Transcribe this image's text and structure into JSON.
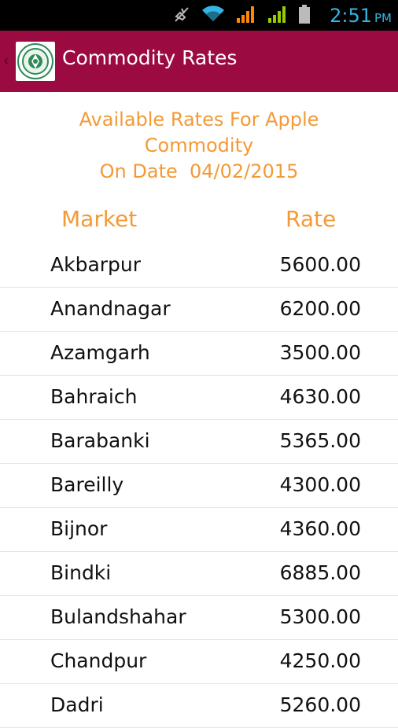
{
  "status_bar": {
    "time": "2:51",
    "ampm": "PM",
    "accent_color": "#33b5e5",
    "icons": [
      "mute-icon",
      "wifi-icon",
      "signal-icon-1",
      "signal-icon-2",
      "battery-icon"
    ]
  },
  "action_bar": {
    "title": "Commodity Rates",
    "background_color": "#9b0a40"
  },
  "heading": {
    "line1": "Available Rates For Apple",
    "line2": "Commodity",
    "line3": "On Date  04/02/2015"
  },
  "table": {
    "header_market": "Market",
    "header_rate": "Rate",
    "rows": [
      {
        "market": "Akbarpur",
        "rate": "5600.00"
      },
      {
        "market": "Anandnagar",
        "rate": "6200.00"
      },
      {
        "market": "Azamgarh",
        "rate": "3500.00"
      },
      {
        "market": "Bahraich",
        "rate": "4630.00"
      },
      {
        "market": "Barabanki",
        "rate": "5365.00"
      },
      {
        "market": "Bareilly",
        "rate": "4300.00"
      },
      {
        "market": "Bijnor",
        "rate": "4360.00"
      },
      {
        "market": "Bindki",
        "rate": "6885.00"
      },
      {
        "market": "Bulandshahar",
        "rate": "5300.00"
      },
      {
        "market": "Chandpur",
        "rate": "4250.00"
      },
      {
        "market": "Dadri",
        "rate": "5260.00"
      }
    ]
  },
  "accent_text_color": "#f39a36"
}
